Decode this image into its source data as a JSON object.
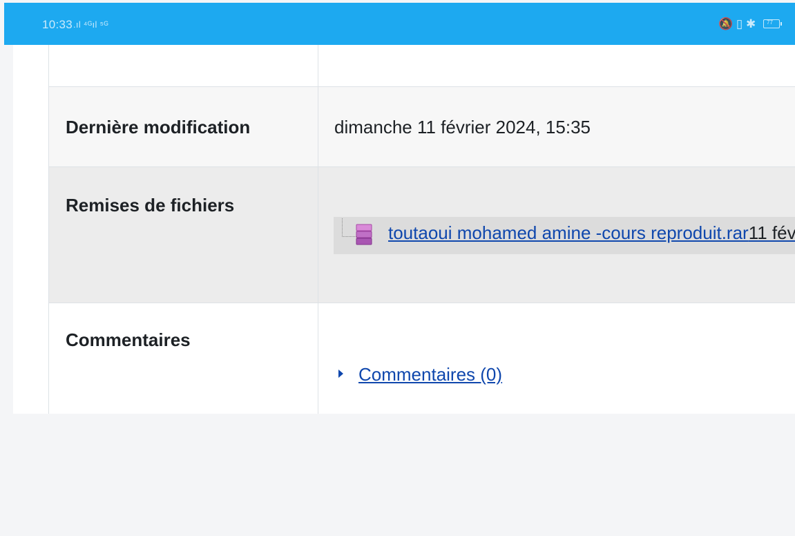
{
  "status_bar": {
    "time": "10:33",
    "signal_text": ".ıl ⁴ᴳıl ⁵ᴳ",
    "right_icons_text": "🔕 ▯ ✱",
    "battery": "77"
  },
  "rows": [
    {
      "label": "",
      "value": ""
    },
    {
      "label": "Dernière modification",
      "value": "dimanche 11 février 2024, 15:35"
    },
    {
      "label": "Remises de fichiers",
      "file": {
        "name": "toutaoui mohamed amine -cours reproduit.rar",
        "date": "11 fév",
        "icon": "archive-icon"
      }
    },
    {
      "label": "Commentaires",
      "comments_link": "Commentaires (0)"
    }
  ],
  "colors": {
    "status_bar": "#1da9f0",
    "link": "#0f47ad",
    "row_alt": "#f7f7f7",
    "row_selected": "#ececec"
  }
}
